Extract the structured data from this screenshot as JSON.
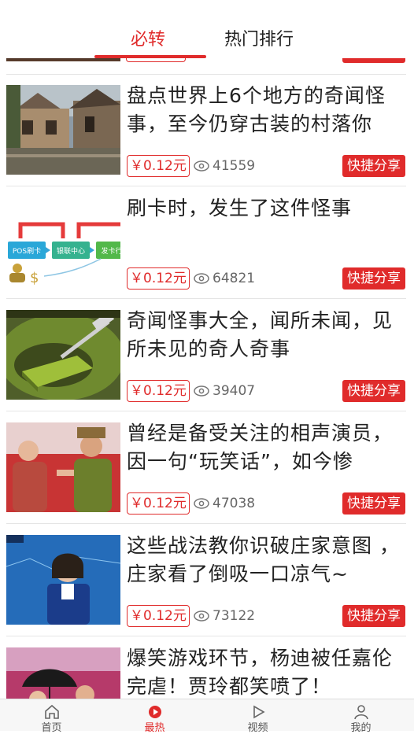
{
  "tabs": {
    "active": "必转",
    "other": "热门排行"
  },
  "articles": [
    {
      "title": "盘点世界上6个地方的奇闻怪事，至今仍穿古装的村落你",
      "price": "￥0.12元",
      "views": "41559",
      "share": "快捷分享"
    },
    {
      "title": "刷卡时，发生了这件怪事",
      "price": "￥0.12元",
      "views": "64821",
      "share": "快捷分享",
      "thumb_labels": {
        "pos": "POS刷卡",
        "center": "银联中心",
        "issuer": "发卡行"
      }
    },
    {
      "title": "奇闻怪事大全，闻所未闻，见所未见的奇人奇事",
      "price": "￥0.12元",
      "views": "39407",
      "share": "快捷分享"
    },
    {
      "title": "曾经是备受关注的相声演员，因一句“玩笑话”，如今惨",
      "price": "￥0.12元",
      "views": "47038",
      "share": "快捷分享"
    },
    {
      "title": " 这些战法教你识破庄家意图 ，庄家看了倒吸一口凉气~",
      "price": "￥0.12元",
      "views": "73122",
      "share": "快捷分享"
    },
    {
      "title": "爆笑游戏环节，杨迪被任嘉伦完虐！贾玲都笑喷了！"
    }
  ],
  "bottom_nav": [
    {
      "label": "首页",
      "icon": "home-icon"
    },
    {
      "label": "最热",
      "icon": "hot-icon"
    },
    {
      "label": "视频",
      "icon": "play-icon"
    },
    {
      "label": "我的",
      "icon": "user-icon"
    }
  ],
  "colors": {
    "accent": "#e02b2b",
    "text": "#222222",
    "muted": "#666666"
  }
}
